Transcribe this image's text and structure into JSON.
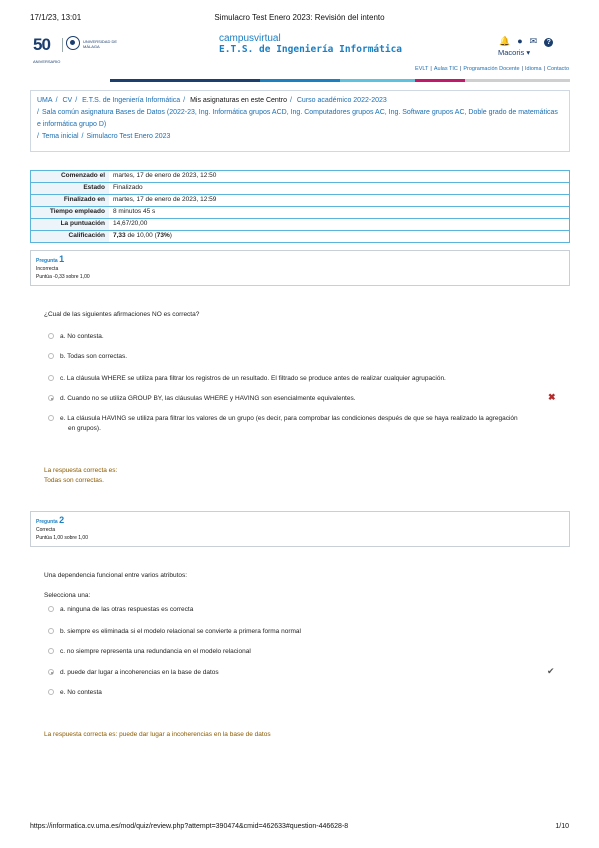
{
  "print": {
    "datetime": "17/1/23, 13:01",
    "title": "Simulacro Test Enero 2023: Revisión del intento",
    "url": "https://informatica.cv.uma.es/mod/quiz/review.php?attempt=390474&cmid=462633#question-446628-8",
    "page": "1/10"
  },
  "header": {
    "logo_text": "50",
    "logo_sub": "ANIVERSARIO",
    "uma_text": "UNIVERSIDAD DE MÁLAGA",
    "campus_line1": "campusvirtual",
    "campus_line2": "E.T.S. de Ingeniería Informática",
    "user_name": "Macoris",
    "icons": [
      "bell-icon",
      "chat-icon",
      "mail-icon",
      "help-icon"
    ],
    "links": [
      "EVLT",
      "Aulas TIC",
      "Programación Docente",
      "Idioma",
      "Contacto"
    ],
    "colors": [
      "#1b3e6f",
      "#1b7fc3",
      "#5bc3e0",
      "#c21a6b",
      "#cfcfcf"
    ]
  },
  "breadcrumb": {
    "items": [
      "UMA",
      "CV",
      "E.T.S. de Ingeniería Informática",
      "Mis asignaturas en este Centro",
      "Curso académico 2022-2023"
    ],
    "line2": "Sala común asignatura Bases de Datos (2022-23, Ing. Informática grupos ACD, Ing. Computadores grupos AC, Ing. Software grupos AC, Doble grado de matemáticas e informática grupo D)",
    "line3": [
      "Tema inicial",
      "Simulacro Test Enero 2023"
    ]
  },
  "summary": [
    {
      "k": "Comenzado el",
      "v": "martes, 17 de enero de 2023, 12:50"
    },
    {
      "k": "Estado",
      "v": "Finalizado"
    },
    {
      "k": "Finalizado en",
      "v": "martes, 17 de enero de 2023, 12:59"
    },
    {
      "k": "Tiempo empleado",
      "v": "8 minutos 45 s"
    },
    {
      "k": "La puntuación",
      "v": "14,67/20,00"
    },
    {
      "k": "Calificación",
      "v_bold": "7,33",
      "v": " de 10,00 (",
      "v_bold2": "73%",
      "v_end": ")"
    }
  ],
  "q1": {
    "label": "Pregunta",
    "number": "1",
    "status": "Incorrecta",
    "score": "Puntúa -0,33 sobre 1,00",
    "text": "¿Cual de las siguientes afirmaciones NO es correcta?",
    "options": [
      "a. No contesta.",
      "b. Todas son correctas.",
      "c. La cláusula WHERE se utiliza para filtrar los registros de un resultado. El filtrado se produce antes de realizar cualquier agrupación.",
      "d. Cuando no se utiliza GROUP BY, las cláusulas WHERE y HAVING son esencialmente equivalentes.",
      "e. La cláusula HAVING se utiliza para filtrar los valores de un grupo (es decir, para comprobar las condiciones después de que se haya realizado la agregación",
      "en grupos)."
    ],
    "feedback1": "La respuesta correcta es:",
    "feedback2": "Todas son correctas."
  },
  "q2": {
    "label": "Pregunta",
    "number": "2",
    "status": "Correcta",
    "score": "Puntúa 1,00 sobre 1,00",
    "text": "Una dependencia funcional entre varios atributos:",
    "select": "Selecciona una:",
    "options": [
      "a. ninguna de las otras respuestas es correcta",
      "b. siempre es eliminada si el modelo relacional se convierte a primera forma normal",
      "c. no siempre representa una redundancia en el modelo relacional",
      "d. puede dar lugar a incoherencias en la base de datos",
      "e. No contesta"
    ],
    "feedback": "La respuesta correcta es: puede dar lugar a incoherencias en la base de datos"
  }
}
